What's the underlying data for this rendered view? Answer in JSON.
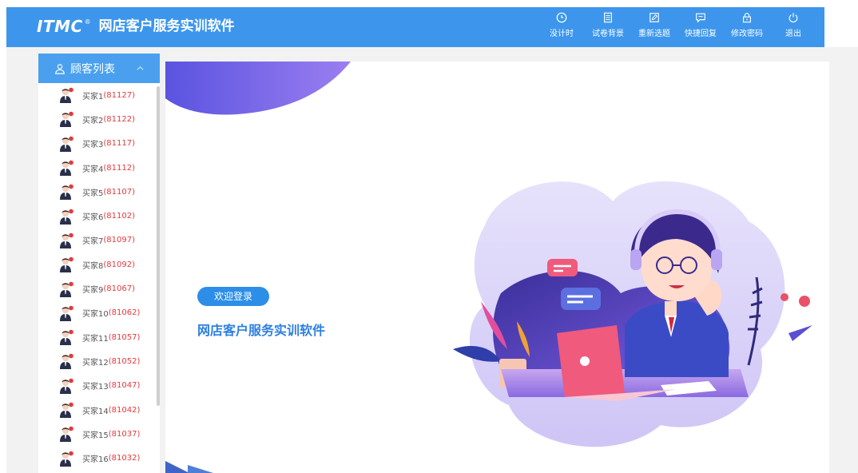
{
  "header": {
    "logo_text": "ITMC",
    "logo_mark": "®",
    "app_title": "网店客户服务实训软件",
    "nav": [
      {
        "label": "没计时",
        "icon": "clock-icon"
      },
      {
        "label": "试卷背景",
        "icon": "document-icon"
      },
      {
        "label": "重新选题",
        "icon": "edit-icon"
      },
      {
        "label": "快捷回复",
        "icon": "chat-icon"
      },
      {
        "label": "修改密码",
        "icon": "lock-icon"
      },
      {
        "label": "退出",
        "icon": "power-icon"
      }
    ]
  },
  "sidebar": {
    "title": "顾客列表",
    "customers": [
      {
        "name": "买家1",
        "id": "(81127)"
      },
      {
        "name": "买家2",
        "id": "(81122)"
      },
      {
        "name": "买家3",
        "id": "(81117)"
      },
      {
        "name": "买家4",
        "id": "(81112)"
      },
      {
        "name": "买家5",
        "id": "(81107)"
      },
      {
        "name": "买家6",
        "id": "(81102)"
      },
      {
        "name": "买家7",
        "id": "(81097)"
      },
      {
        "name": "买家8",
        "id": "(81092)"
      },
      {
        "name": "买家9",
        "id": "(81067)"
      },
      {
        "name": "买家10",
        "id": "(81062)"
      },
      {
        "name": "买家11",
        "id": "(81057)"
      },
      {
        "name": "买家12",
        "id": "(81052)"
      },
      {
        "name": "买家13",
        "id": "(81047)"
      },
      {
        "name": "买家14",
        "id": "(81042)"
      },
      {
        "name": "买家15",
        "id": "(81037)"
      },
      {
        "name": "买家16",
        "id": "(81032)"
      }
    ]
  },
  "main": {
    "welcome_badge": "欢迎登录",
    "welcome_title": "网店客户服务实训软件"
  },
  "colors": {
    "header": "#3d96ec",
    "sidebar_header": "#4aa0ef",
    "customer_id": "#e4393c",
    "welcome_badge": "#2d8ee8",
    "welcome_title": "#2d7fe0"
  }
}
